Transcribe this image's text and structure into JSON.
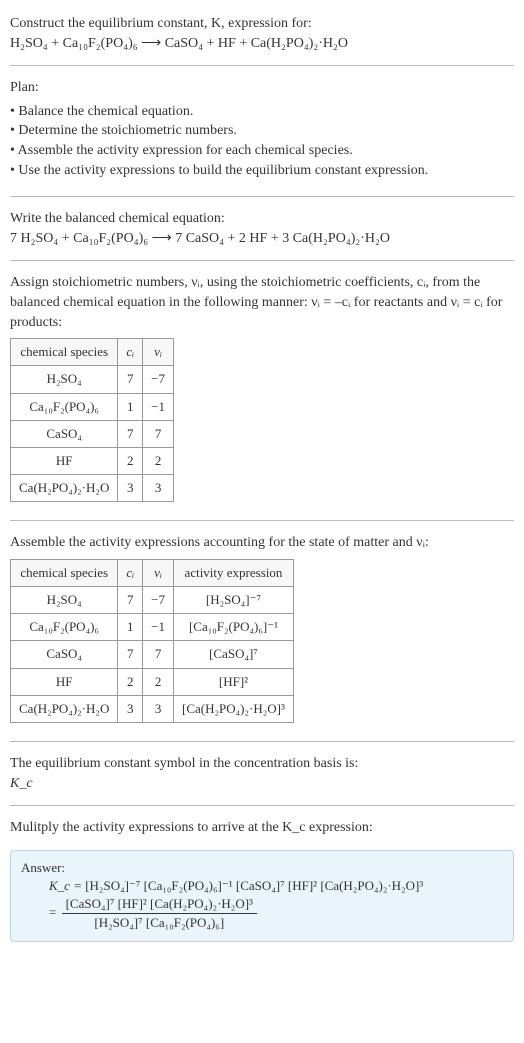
{
  "intro": {
    "line1": "Construct the equilibrium constant, K, expression for:",
    "equation_unbalanced": "H₂SO₄ + Ca₁₀F₂(PO₄)₆ ⟶ CaSO₄ + HF + Ca(H₂PO₄)₂·H₂O"
  },
  "plan": {
    "heading": "Plan:",
    "items": [
      "Balance the chemical equation.",
      "Determine the stoichiometric numbers.",
      "Assemble the activity expression for each chemical species.",
      "Use the activity expressions to build the equilibrium constant expression."
    ]
  },
  "balanced": {
    "heading": "Write the balanced chemical equation:",
    "equation": "7 H₂SO₄ + Ca₁₀F₂(PO₄)₆ ⟶ 7 CaSO₄ + 2 HF + 3 Ca(H₂PO₄)₂·H₂O"
  },
  "stoich": {
    "heading": "Assign stoichiometric numbers, νᵢ, using the stoichiometric coefficients, cᵢ, from the balanced chemical equation in the following manner: νᵢ = –cᵢ for reactants and νᵢ = cᵢ for products:",
    "columns": [
      "chemical species",
      "cᵢ",
      "νᵢ"
    ],
    "rows": [
      [
        "H₂SO₄",
        "7",
        "−7"
      ],
      [
        "Ca₁₀F₂(PO₄)₆",
        "1",
        "−1"
      ],
      [
        "CaSO₄",
        "7",
        "7"
      ],
      [
        "HF",
        "2",
        "2"
      ],
      [
        "Ca(H₂PO₄)₂·H₂O",
        "3",
        "3"
      ]
    ]
  },
  "activity": {
    "heading": "Assemble the activity expressions accounting for the state of matter and νᵢ:",
    "columns": [
      "chemical species",
      "cᵢ",
      "νᵢ",
      "activity expression"
    ],
    "rows": [
      [
        "H₂SO₄",
        "7",
        "−7",
        "[H₂SO₄]⁻⁷"
      ],
      [
        "Ca₁₀F₂(PO₄)₆",
        "1",
        "−1",
        "[Ca₁₀F₂(PO₄)₆]⁻¹"
      ],
      [
        "CaSO₄",
        "7",
        "7",
        "[CaSO₄]⁷"
      ],
      [
        "HF",
        "2",
        "2",
        "[HF]²"
      ],
      [
        "Ca(H₂PO₄)₂·H₂O",
        "3",
        "3",
        "[Ca(H₂PO₄)₂·H₂O]³"
      ]
    ]
  },
  "symbol": {
    "heading": "The equilibrium constant symbol in the concentration basis is:",
    "value": "K_c"
  },
  "multiply": {
    "heading": "Mulitply the activity expressions to arrive at the K_c expression:"
  },
  "answer": {
    "label": "Answer:",
    "line1_lhs": "K_c =",
    "line1_rhs": "[H₂SO₄]⁻⁷ [Ca₁₀F₂(PO₄)₆]⁻¹ [CaSO₄]⁷ [HF]² [Ca(H₂PO₄)₂·H₂O]³",
    "frac_num": "[CaSO₄]⁷ [HF]² [Ca(H₂PO₄)₂·H₂O]³",
    "frac_den": "[H₂SO₄]⁷ [Ca₁₀F₂(PO₄)₆]"
  },
  "chart_data": {
    "type": "table",
    "tables": [
      {
        "title": "Stoichiometric numbers",
        "columns": [
          "chemical species",
          "c_i",
          "ν_i"
        ],
        "rows": [
          [
            "H2SO4",
            7,
            -7
          ],
          [
            "Ca10F2(PO4)6",
            1,
            -1
          ],
          [
            "CaSO4",
            7,
            7
          ],
          [
            "HF",
            2,
            2
          ],
          [
            "Ca(H2PO4)2·H2O",
            3,
            3
          ]
        ]
      },
      {
        "title": "Activity expressions",
        "columns": [
          "chemical species",
          "c_i",
          "ν_i",
          "activity expression"
        ],
        "rows": [
          [
            "H2SO4",
            7,
            -7,
            "[H2SO4]^-7"
          ],
          [
            "Ca10F2(PO4)6",
            1,
            -1,
            "[Ca10F2(PO4)6]^-1"
          ],
          [
            "CaSO4",
            7,
            7,
            "[CaSO4]^7"
          ],
          [
            "HF",
            2,
            2,
            "[HF]^2"
          ],
          [
            "Ca(H2PO4)2·H2O",
            3,
            3,
            "[Ca(H2PO4)2·H2O]^3"
          ]
        ]
      }
    ]
  }
}
